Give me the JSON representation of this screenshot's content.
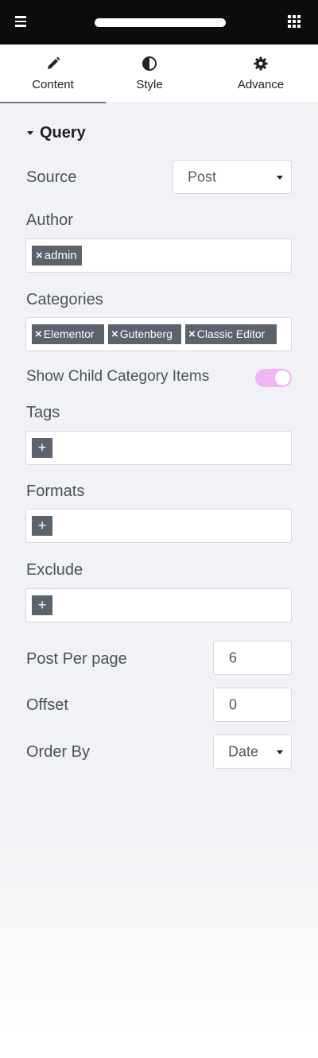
{
  "topbar": {
    "menu_icon": "hamburger-icon",
    "apps_icon": "grid-icon"
  },
  "tabs": [
    {
      "label": "Content",
      "icon": "pencil-icon",
      "active": true
    },
    {
      "label": "Style",
      "icon": "contrast-icon",
      "active": false
    },
    {
      "label": "Advance",
      "icon": "gear-icon",
      "active": false
    }
  ],
  "section": {
    "title": "Query",
    "expanded": true
  },
  "fields": {
    "source": {
      "label": "Source",
      "value": "Post"
    },
    "author": {
      "label": "Author",
      "chips": [
        "admin"
      ]
    },
    "categories": {
      "label": "Categories",
      "chips": [
        "Elementor",
        "Gutenberg",
        "Classic Editor"
      ]
    },
    "show_child": {
      "label": "Show Child Category Items",
      "enabled": true
    },
    "tags": {
      "label": "Tags",
      "add_label": "+"
    },
    "formats": {
      "label": "Formats",
      "add_label": "+"
    },
    "exclude": {
      "label": "Exclude",
      "add_label": "+"
    },
    "post_per_page": {
      "label": "Post Per page",
      "value": "6"
    },
    "offset": {
      "label": "Offset",
      "value": "0"
    },
    "order_by": {
      "label": "Order By",
      "value": "Date"
    }
  },
  "chip_remove_glyph": "×",
  "colors": {
    "topbar": "#0b0c0e",
    "chip": "#5b636d",
    "toggle_on": "#f0b6f2",
    "panel_bg": "#f1f2f5"
  }
}
